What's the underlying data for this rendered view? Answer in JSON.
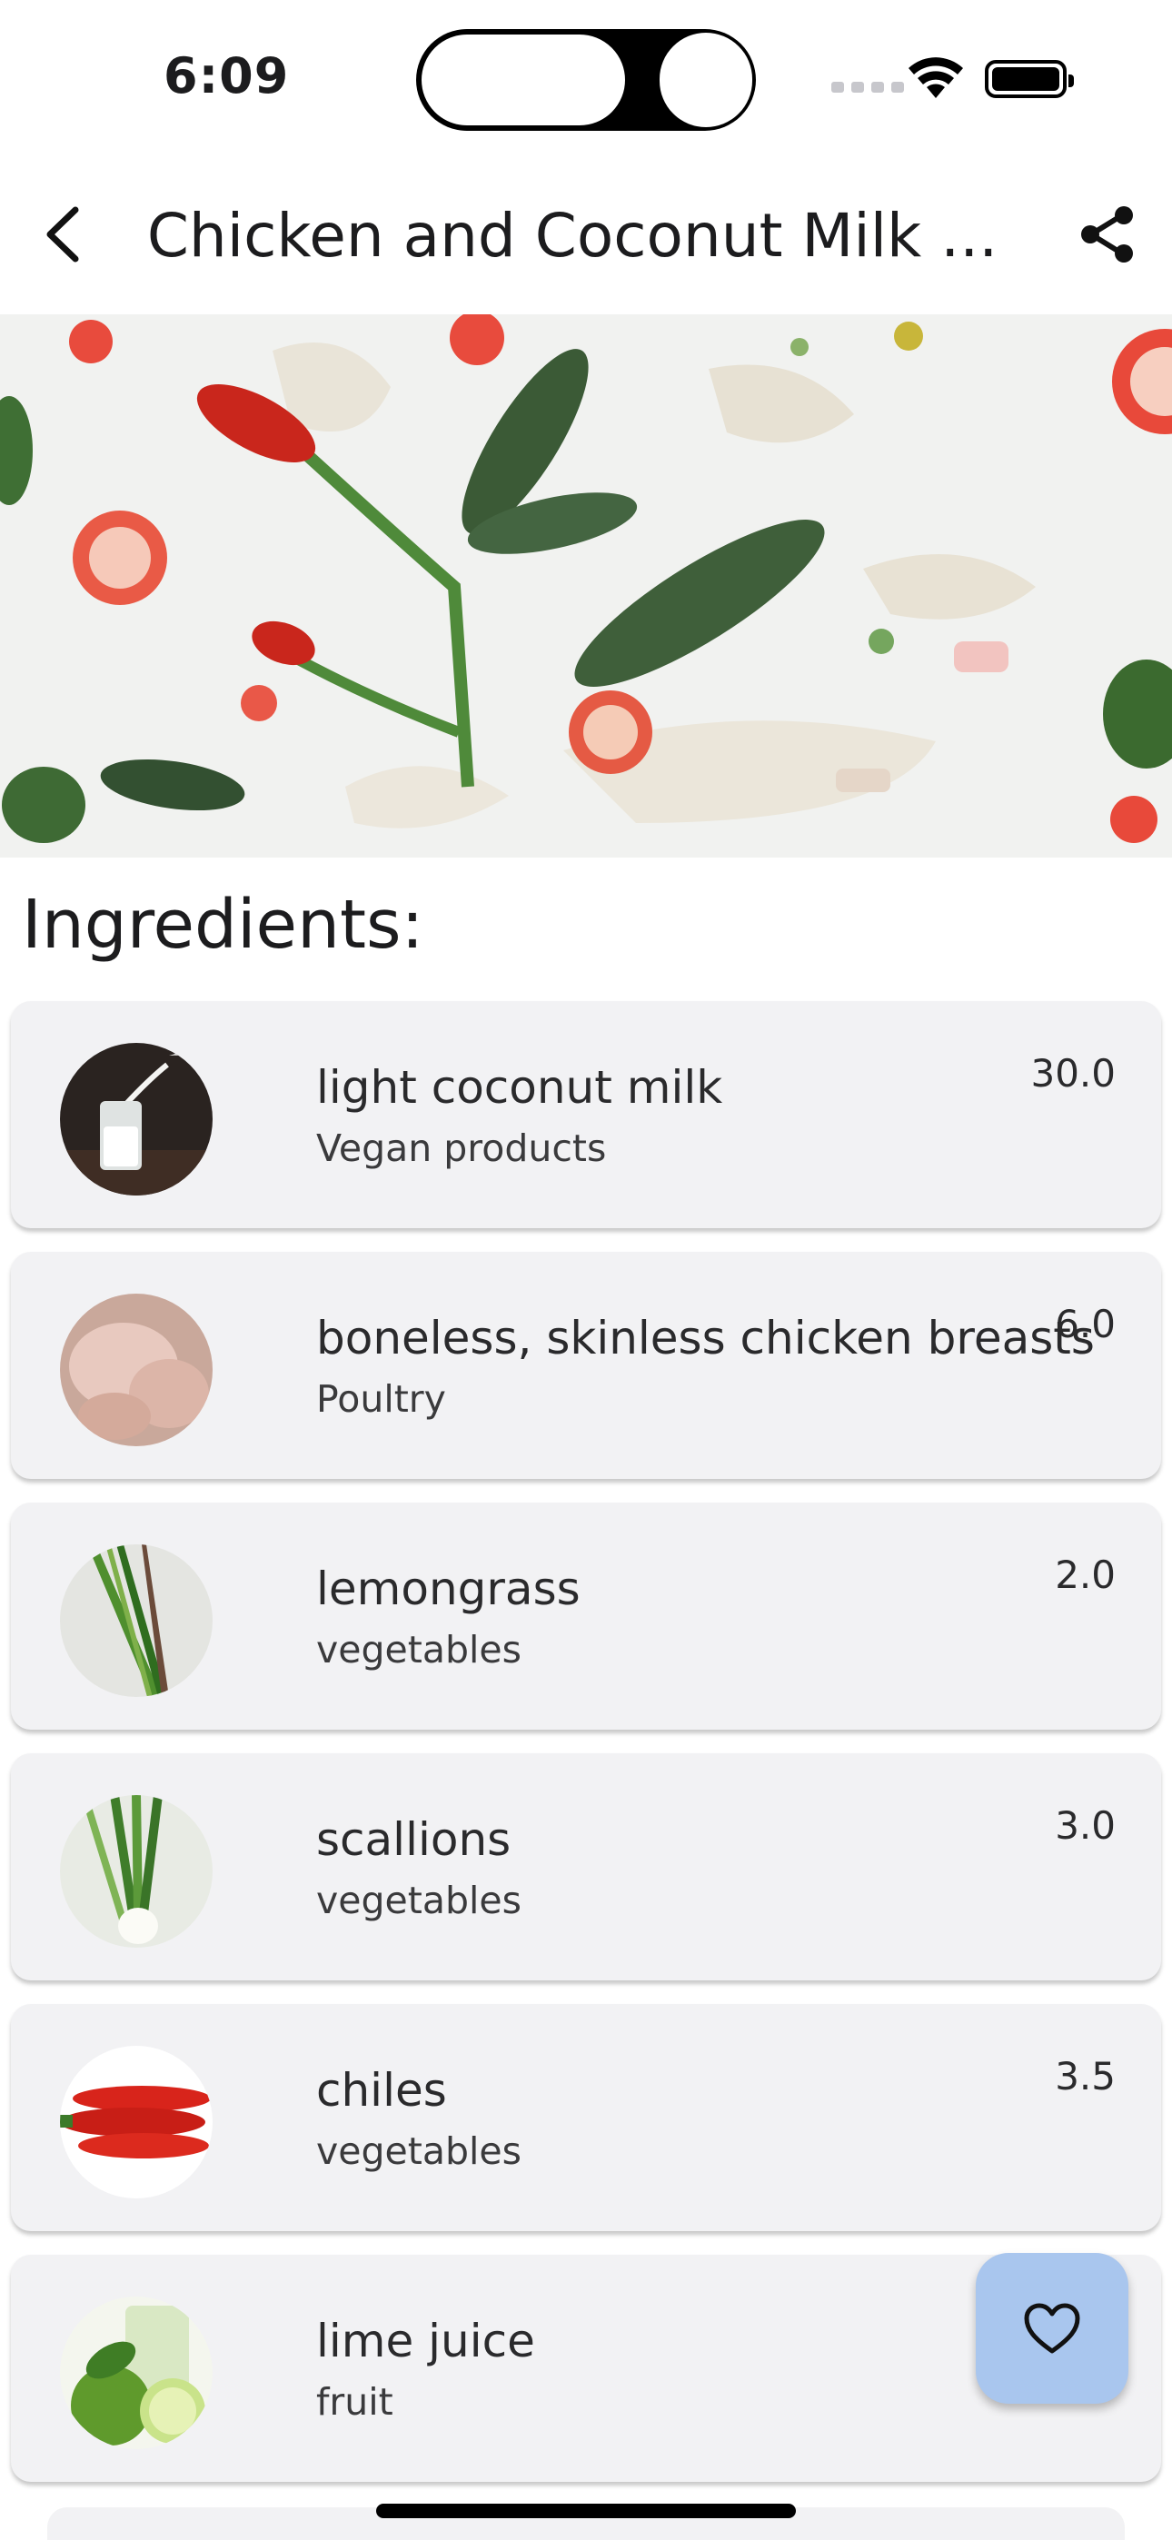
{
  "status_bar": {
    "time": "6:09"
  },
  "app_bar": {
    "title": "Chicken and Coconut Milk ...",
    "back_icon": "chevron-left-icon",
    "share_icon": "share-icon"
  },
  "section": {
    "title": "Ingredients:"
  },
  "ingredients": [
    {
      "name": "light coconut milk",
      "category": "Vegan products",
      "quantity": "30.0",
      "icon": "milk-thumbnail"
    },
    {
      "name": "boneless, skinless chicken breasts",
      "category": "Poultry",
      "quantity": "6.0",
      "icon": "chicken-thumbnail"
    },
    {
      "name": "lemongrass",
      "category": "vegetables",
      "quantity": "2.0",
      "icon": "lemongrass-thumbnail"
    },
    {
      "name": "scallions",
      "category": "vegetables",
      "quantity": "3.0",
      "icon": "scallions-thumbnail"
    },
    {
      "name": "chiles",
      "category": "vegetables",
      "quantity": "3.5",
      "icon": "chiles-thumbnail"
    },
    {
      "name": "lime juice",
      "category": "fruit",
      "quantity": "",
      "icon": "lime-thumbnail"
    }
  ],
  "fab": {
    "icon": "heart-icon"
  },
  "colors": {
    "card_background": "#f2f2f4",
    "fab_background": "#a9c6ee"
  }
}
